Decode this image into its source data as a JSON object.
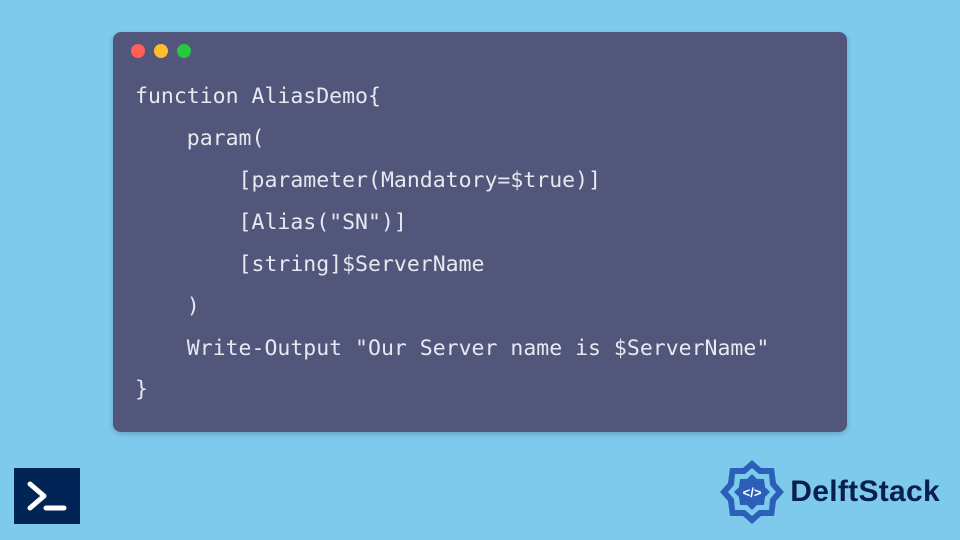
{
  "code": {
    "lines": [
      "function AliasDemo{",
      "    param(",
      "        [parameter(Mandatory=$true)]",
      "        [Alias(\"SN\")]",
      "        [string]$ServerName",
      "    )",
      "    Write-Output \"Our Server name is $ServerName\"",
      "}"
    ]
  },
  "window": {
    "dot_colors": {
      "red": "#ff5f56",
      "yellow": "#ffbd2e",
      "green": "#27c93f"
    }
  },
  "brand": {
    "name": "DelftStack"
  },
  "colors": {
    "page_bg": "#7ecaed",
    "code_bg": "#51567a",
    "code_fg": "#e8e8f0",
    "ps_bg": "#012456",
    "brand_text": "#0a1f4d",
    "brand_logo": "#2b5fb8"
  }
}
